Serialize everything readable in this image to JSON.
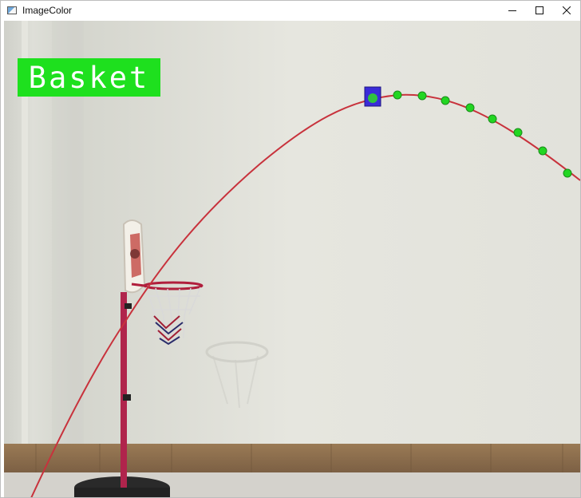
{
  "window": {
    "title": "ImageColor",
    "icon": "app-window-icon",
    "controls": [
      "minimize-icon",
      "maximize-icon",
      "close-icon"
    ]
  },
  "overlay": {
    "label": "Basket",
    "label_color": "#1ee01e",
    "trajectory_color": "#c8323c",
    "detection_color": "#22d622",
    "ball_box_color": "#3a2bd8"
  }
}
